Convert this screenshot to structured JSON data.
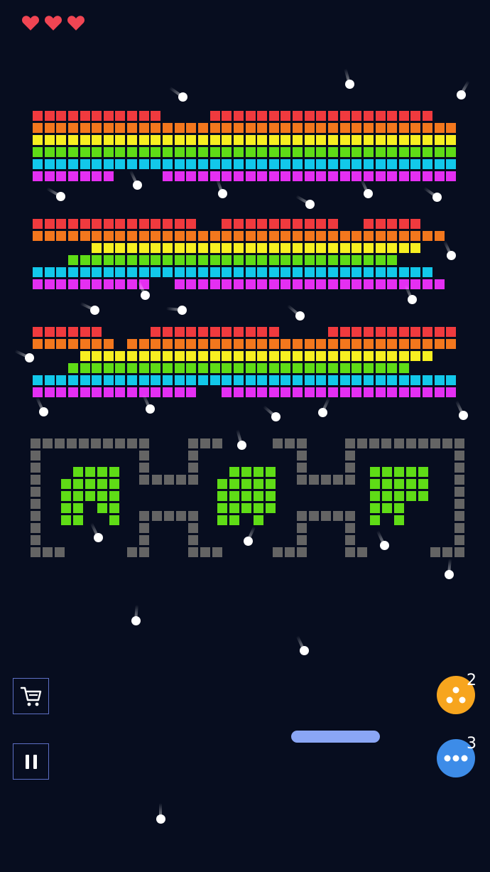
{
  "game": {
    "lives": 3,
    "colors": {
      "background": "#070d1f",
      "red": "#f03a3e",
      "orange": "#f3771d",
      "yellow": "#f7ef21",
      "green": "#5fdc16",
      "cyan": "#12c8ea",
      "magenta": "#e42ff2",
      "wall": "#646464",
      "paddle": "#8aa6f5",
      "life": "#f04553"
    },
    "powerups": [
      {
        "name": "split-ball",
        "color": "#f7a51e",
        "count": "2"
      },
      {
        "name": "multi-ball",
        "color": "#3d8ce8",
        "count": "3"
      }
    ],
    "buttons": {
      "shop": "cart-icon",
      "pause": "pause-icon"
    }
  }
}
